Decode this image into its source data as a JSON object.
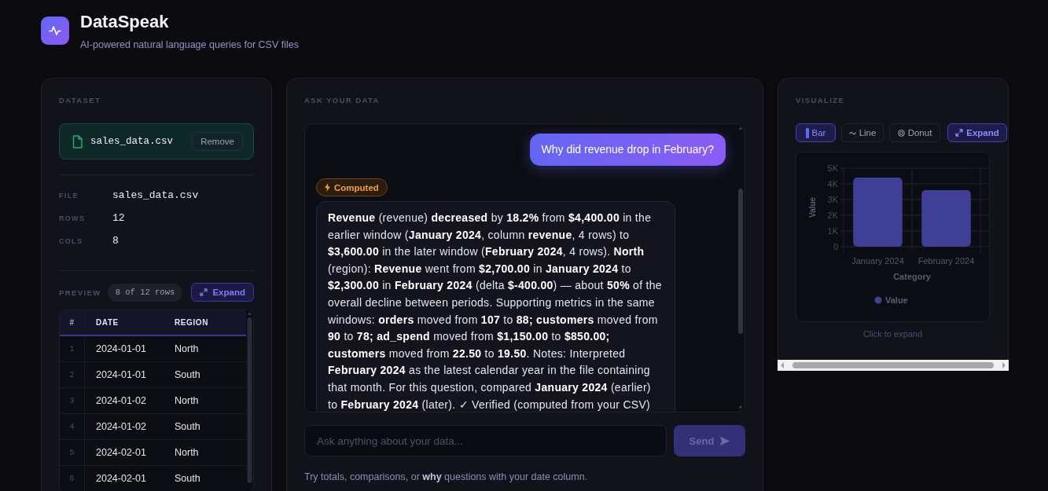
{
  "header": {
    "title": "DataSpeak",
    "subtitle": "AI-powered natural language queries for CSV files"
  },
  "dataset": {
    "heading": "DATASET",
    "file_chip": {
      "name": "sales_data.csv",
      "remove_button": "Remove"
    },
    "details": [
      {
        "label": "FILE",
        "value": "sales_data.csv"
      },
      {
        "label": "ROWS",
        "value": "12"
      },
      {
        "label": "COLS",
        "value": "8"
      }
    ],
    "preview": {
      "label": "PREVIEW",
      "count": "8 of 12 rows",
      "expand_button": "Expand",
      "table": {
        "columns": [
          "#",
          "DATE",
          "REGION"
        ],
        "rows": [
          [
            "1",
            "2024-01-01",
            "North"
          ],
          [
            "2",
            "2024-01-01",
            "South"
          ],
          [
            "3",
            "2024-01-02",
            "North"
          ],
          [
            "4",
            "2024-01-02",
            "South"
          ],
          [
            "5",
            "2024-02-01",
            "North"
          ],
          [
            "6",
            "2024-02-01",
            "South"
          ]
        ]
      }
    }
  },
  "ask": {
    "heading": "ASK YOUR DATA",
    "messages": [
      {
        "kind": "user",
        "text": "Why did revenue drop in February?"
      },
      {
        "kind": "assistant",
        "badge": "Computed",
        "text": "**Revenue** (revenue) **decreased** by **18.2%** from **$4,400.00** in the earlier window (**January 2024**, column **revenue**, 4 rows) to **$3,600.00** in the later window (**February 2024**, 4 rows). **North** (region): **Revenue** went from **$2,700.00** in **January 2024** to **$2,300.00** in **February 2024** (delta **$-400.00**) — about **50%** of the overall decline between periods. Supporting metrics in the same windows: **orders** moved from **107** to **88;** **customers** moved from **90** to **78;** **ad_spend** moved from **$1,150.00** to **$850.00;** **customers** moved from **22.50** to **19.50**. Notes: Interpreted **February 2024** as the latest calendar year in the file containing that month. For this question, compared **January 2024** (earlier) to **February 2024** (later). ✓ Verified (computed from your CSV)"
      }
    ],
    "input": {
      "placeholder": "Ask anything about your data..."
    },
    "send_button": {
      "label": "Send",
      "disabled": true
    },
    "hint": "Try totals, comparisons, or **why** questions with your date column."
  },
  "visualize": {
    "heading": "VISUALIZE",
    "chart_types": [
      {
        "kind": "bar",
        "label": "Bar",
        "selected": true
      },
      {
        "kind": "line",
        "label": "Line",
        "selected": false
      },
      {
        "kind": "donut",
        "label": "Donut",
        "selected": false
      }
    ],
    "expand_button": "Expand",
    "chart_data": {
      "type": "bar",
      "xlabel": "Category",
      "ylabel": "Value",
      "categories": [
        "January 2024",
        "February 2024"
      ],
      "series": [
        {
          "name": "Value",
          "color": "#3f3f96",
          "values": [
            4400,
            3600
          ]
        }
      ],
      "ylim": [
        0,
        5000
      ],
      "yticks": [
        {
          "value": 0,
          "label": "0"
        },
        {
          "value": 1000,
          "label": "1K"
        },
        {
          "value": 2000,
          "label": "2K"
        },
        {
          "value": 3000,
          "label": "3K"
        },
        {
          "value": 4000,
          "label": "4K"
        },
        {
          "value": 5000,
          "label": "5K"
        }
      ],
      "grid": true
    },
    "caption": "Click to expand"
  }
}
